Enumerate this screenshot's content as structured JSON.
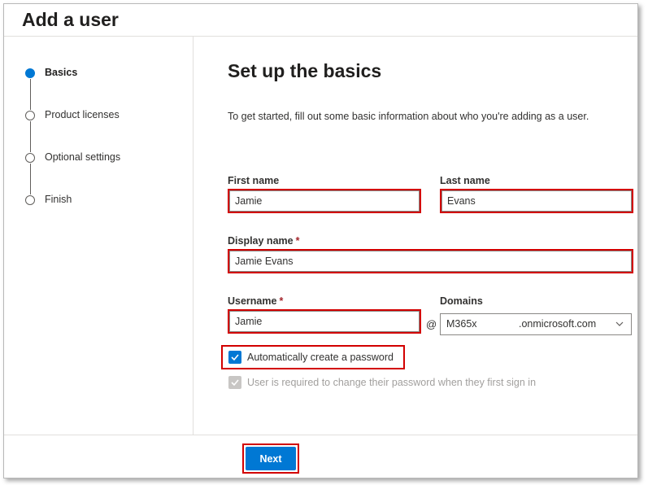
{
  "page": {
    "title": "Add a user"
  },
  "steps": [
    {
      "label": "Basics",
      "state": "active"
    },
    {
      "label": "Product licenses",
      "state": "pending"
    },
    {
      "label": "Optional settings",
      "state": "pending"
    },
    {
      "label": "Finish",
      "state": "pending"
    }
  ],
  "main": {
    "title": "Set up the basics",
    "intro": "To get started, fill out some basic information about who you're adding as a user."
  },
  "form": {
    "first_name": {
      "label": "First name",
      "value": "Jamie"
    },
    "last_name": {
      "label": "Last name",
      "value": "Evans"
    },
    "display_name": {
      "label": "Display name",
      "required_mark": "*",
      "value": "Jamie Evans"
    },
    "username": {
      "label": "Username",
      "required_mark": "*",
      "value": "Jamie"
    },
    "at_symbol": "@",
    "domains": {
      "label": "Domains",
      "value_prefix": "M365x",
      "value_suffix": ".onmicrosoft.com"
    },
    "auto_password": {
      "label": "Automatically create a password",
      "checked": true
    },
    "require_change": {
      "label": "User is required to change their password when they first sign in",
      "checked": true,
      "disabled": true
    }
  },
  "footer": {
    "next_label": "Next"
  },
  "colors": {
    "accent": "#0078d4",
    "highlight": "#d20000",
    "required": "#a4262c"
  },
  "icons": {
    "dropdown": "chevron-down-icon",
    "checkmark": "checkmark-icon"
  }
}
